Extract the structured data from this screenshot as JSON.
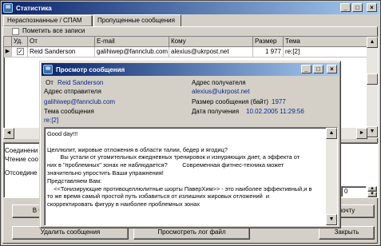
{
  "main_window": {
    "title": "Статистика",
    "controls": {
      "minimize": "_",
      "maximize": "□",
      "close": "×"
    }
  },
  "tabs": [
    {
      "label": "Нераспознанные / СПАМ",
      "active": false
    },
    {
      "label": "Пропущенные сообщения",
      "active": true
    }
  ],
  "mark_all_label": "Пометить все записи",
  "grid": {
    "columns": [
      "Уд.",
      "От",
      "E-mail",
      "Кому",
      "Размер",
      "Тема"
    ],
    "rows": [
      {
        "from": "Reid Sanderson",
        "email": "galihiwep@fannclub.com",
        "to": "alexius@ukrpost.net",
        "size": "1 977",
        "subject": "re:[2]",
        "checked": true
      }
    ]
  },
  "left_labels": [
    "Соединени",
    "Чтение соо",
    "Отсоедине"
  ],
  "spinner_value": "0",
  "buttons": {
    "left_partial": "В чер",
    "right_partial": "почту",
    "delete_messages": "Удалить сообщения",
    "view_log": "Просмотреть лог файл",
    "close": "Закрыть"
  },
  "dialog": {
    "title": "Просмотр сообщения",
    "from_label": "От",
    "from_value": "Reid Sanderson",
    "sender_address_label": "Адрес отправителя",
    "sender_address_value": "galihiwep@fannclub.com",
    "subject_label": "Тема сообщения",
    "subject_value": "re:[2]",
    "recipient_label": "Адрес получателя",
    "recipient_value": "alexius@ukrpost.net",
    "size_label": "Размер сообщения (байт)",
    "size_value": "1977",
    "date_label": "Дата получения",
    "date_value": "10.02.2005 11:29:56",
    "body_lines": [
      "Good day!!!",
      "",
      "Целлюлит, жировые отложения в области талии, бедер и ягодиц?",
      "        Вы устали от утомительных ежедневных тренировок и изнуряющих диет, а эффекта от",
      "них в \"проблемных\" зонах не наблюдается?         Современная фитнес-техника может",
      "значительно упростить Ваши упражнения!",
      "Представляем Вам:",
      "    <<Тонизирующие противоцеллюлитные шорты ПаверХим>> - это наиболее эффективный,и в",
      "то же время самый простой путь избавиться от излишних жировых отложений  и",
      "скорректировать фигуру в наиболее проблемных зонах"
    ]
  }
}
